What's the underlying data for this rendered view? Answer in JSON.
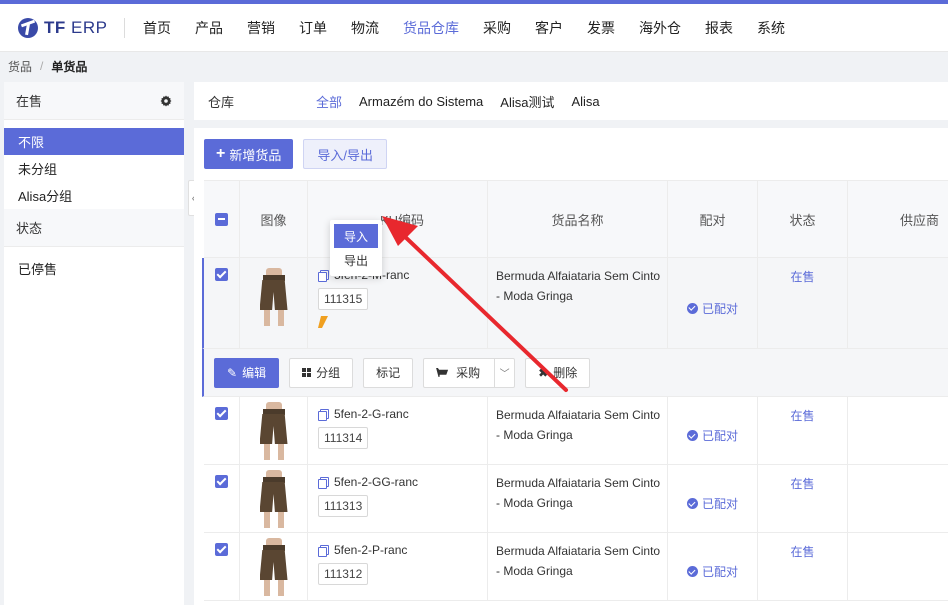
{
  "header": {
    "logo_text_bold": "TF",
    "logo_text_light": " ERP",
    "nav": [
      {
        "label": "首页",
        "active": false
      },
      {
        "label": "产品",
        "active": false
      },
      {
        "label": "营销",
        "active": false
      },
      {
        "label": "订单",
        "active": false
      },
      {
        "label": "物流",
        "active": false
      },
      {
        "label": "货品仓库",
        "active": true
      },
      {
        "label": "采购",
        "active": false
      },
      {
        "label": "客户",
        "active": false
      },
      {
        "label": "发票",
        "active": false
      },
      {
        "label": "海外仓",
        "active": false
      },
      {
        "label": "报表",
        "active": false
      },
      {
        "label": "系统",
        "active": false
      }
    ]
  },
  "breadcrumb": {
    "parent": "货品",
    "separator": "/",
    "current": "单货品"
  },
  "sidebar": {
    "section_sale": "在售",
    "sale_items": [
      "不限",
      "未分组",
      "Alisa分组"
    ],
    "section_status": "状态",
    "status_items": [
      "已停售"
    ],
    "collapse_label": "«"
  },
  "filter": {
    "label": "仓库",
    "options": [
      "全部",
      "Armazém do Sistema",
      "Alisa测试",
      "Alisa"
    ],
    "active_index": 0
  },
  "toolbar": {
    "add_label": "新增货品",
    "import_export_label": "导入/导出",
    "dropdown": [
      "导入",
      "导出"
    ]
  },
  "table": {
    "headers": {
      "image": "图像",
      "sku": "KU编码",
      "name": "货品名称",
      "pair": "配对",
      "status": "状态",
      "supplier": "供应商"
    },
    "rows": [
      {
        "sku": "5fen-2-M-ranc",
        "code": "111315",
        "name_line1": "Bermuda Alfaiataria Sem Cinto",
        "name_line2": "- Moda Gringa",
        "pair": "已配对",
        "status": "在售"
      },
      {
        "sku": "5fen-2-G-ranc",
        "code": "111314",
        "name_line1": "Bermuda Alfaiataria Sem Cinto",
        "name_line2": "- Moda Gringa",
        "pair": "已配对",
        "status": "在售"
      },
      {
        "sku": "5fen-2-GG-ranc",
        "code": "111313",
        "name_line1": "Bermuda Alfaiataria Sem Cinto",
        "name_line2": "- Moda Gringa",
        "pair": "已配对",
        "status": "在售"
      },
      {
        "sku": "5fen-2-P-ranc",
        "code": "111312",
        "name_line1": "Bermuda Alfaiataria Sem Cinto",
        "name_line2": "- Moda Gringa",
        "pair": "已配对",
        "status": "在售"
      }
    ]
  },
  "row_actions": {
    "edit": "编辑",
    "group": "分组",
    "mark": "标记",
    "purchase": "采购",
    "delete": "删除"
  },
  "colors": {
    "accent": "#5b6bd8",
    "annotation_arrow": "#e8282e"
  }
}
